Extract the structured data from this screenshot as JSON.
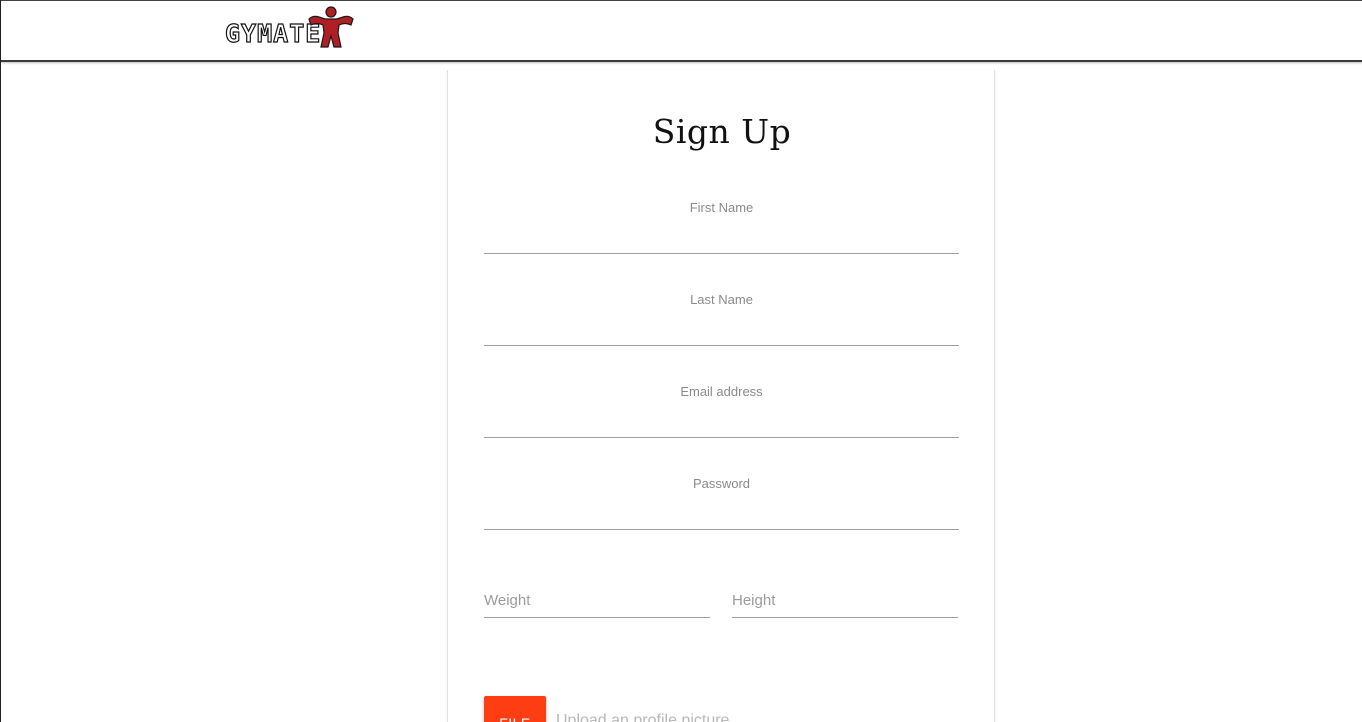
{
  "brand": {
    "logo_text": "GYMATE",
    "figure_icon": "flexing-figure-icon",
    "accent_color": "#b01f24"
  },
  "signup": {
    "title": "Sign Up",
    "first_name_label": "First Name",
    "first_name_value": "",
    "last_name_label": "Last Name",
    "last_name_value": "",
    "email_label": "Email address",
    "email_value": "",
    "password_label": "Password",
    "password_value": "",
    "weight_placeholder": "Weight",
    "height_placeholder": "Height",
    "file_button_label": "FILE",
    "file_placeholder": "Upload an profile picture",
    "button_color": "#ff3d13"
  }
}
